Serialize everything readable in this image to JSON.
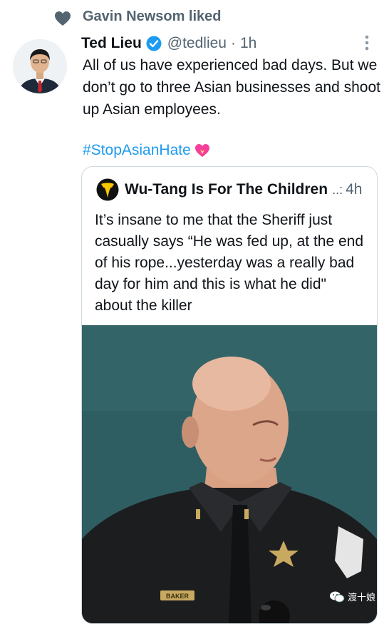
{
  "social_context": {
    "text": "Gavin Newsom liked",
    "icon": "heart-icon"
  },
  "tweet": {
    "author_name": "Ted Lieu",
    "verified": true,
    "handle": "@tedlieu",
    "separator": "·",
    "time": "1h",
    "text": "All of us have experienced bad days. But we don’t go to three Asian businesses and shoot up Asian employees.",
    "hashtag": "#StopAsianHate",
    "hashtag_emoji": "pink-heart-icon"
  },
  "quote": {
    "author_name": "Wu-Tang Is For The Children",
    "separator": "..:",
    "time": "4h",
    "text": "It’s insane to me that the Sheriff just casually says “He was fed up, at the end of his rope...yesterday was a really bad day for him and this is what he did\" about the killer",
    "media": {
      "name_tag": "BAKER"
    }
  },
  "watermark": {
    "text": "渡十娘"
  },
  "colors": {
    "accent": "#1d9bf0",
    "secondary_text": "#536471",
    "border": "#cfd9de"
  }
}
